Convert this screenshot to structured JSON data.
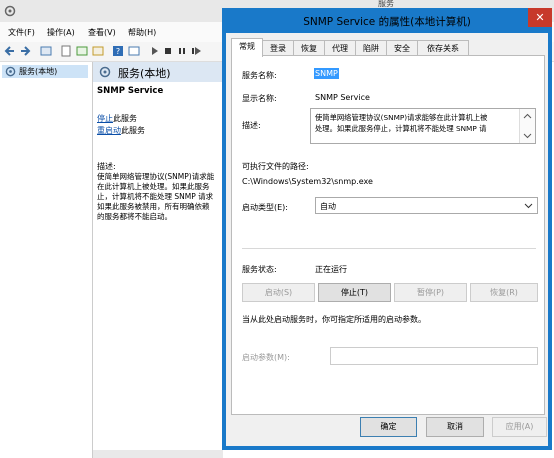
{
  "bg_window": {
    "title_partial": "服务",
    "menu": [
      "文件(F)",
      "操作(A)",
      "查看(V)",
      "帮助(H)"
    ],
    "tree_item": "服务(本地)",
    "detail_header": "服务(本地)",
    "service_name": "SNMP Service",
    "link_stop": "停止",
    "link_stop_suffix": "此服务",
    "link_restart": "重启动",
    "link_restart_suffix": "此服务",
    "desc_label": "描述:",
    "desc_text": "使简单网络管理协议(SNMP)请求能\n在此计算机上被处理。如果此服务\n止，计算机将不能处理 SNMP 请求\n如果此服务被禁用，所有明确依赖\n的服务都将不能启动。"
  },
  "dialog": {
    "title": "SNMP Service 的属性(本地计算机)",
    "close_glyph": "✕",
    "tabs": [
      "常规",
      "登录",
      "恢复",
      "代理",
      "陷阱",
      "安全",
      "依存关系"
    ],
    "labels": {
      "service_name": "服务名称:",
      "display_name": "显示名称:",
      "description": "描述:",
      "exe_path": "可执行文件的路径:",
      "startup_type": "启动类型(E):",
      "service_status": "服务状态:",
      "start_hint": "当从此处启动服务时，你可指定所适用的启动参数。",
      "start_params": "启动参数(M):"
    },
    "values": {
      "service_name": "SNMP",
      "display_name": "SNMP Service",
      "description": "使简单网络管理协议(SNMP)请求能够在此计算机上被\n处理。如果此服务停止，计算机将不能处理 SNMP 请",
      "exe_path": "C:\\Windows\\System32\\snmp.exe",
      "startup_type": "自动",
      "service_status": "正在运行",
      "start_params": ""
    },
    "buttons": {
      "start": "启动(S)",
      "stop": "停止(T)",
      "pause": "暂停(P)",
      "resume": "恢复(R)",
      "ok": "确定",
      "cancel": "取消",
      "apply": "应用(A)"
    }
  },
  "colors": {
    "dialog_frame": "#1979c9",
    "close_button": "#c7392b",
    "link": "#0b4fa8",
    "selection": "#3399ff"
  }
}
